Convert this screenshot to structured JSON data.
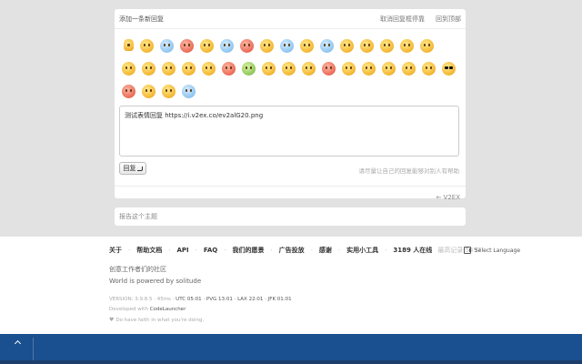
{
  "reply": {
    "title": "添加一条新回复",
    "link_unfollow": "取消回复框停靠",
    "link_top": "回到顶部",
    "textarea_value": "测试表情回复  https://i.v2ex.co/ev2alG20.png",
    "submit_label": "回复",
    "hint": "请尽量让自己的回复能够对别人有帮助",
    "back_link": "← V2EX"
  },
  "emoji_rows": [
    [
      {
        "name": "emoji-small",
        "variant": "small"
      },
      {
        "name": "emoji-grin",
        "variant": ""
      },
      {
        "name": "emoji-cry",
        "variant": "blue"
      },
      {
        "name": "emoji-angry",
        "variant": "red"
      },
      {
        "name": "emoji-wink",
        "variant": ""
      },
      {
        "name": "emoji-scared",
        "variant": "blue"
      },
      {
        "name": "emoji-mad",
        "variant": "red"
      },
      {
        "name": "emoji-shocked",
        "variant": ""
      },
      {
        "name": "emoji-sweat",
        "variant": "blue"
      },
      {
        "name": "emoji-tongue",
        "variant": ""
      },
      {
        "name": "emoji-scream",
        "variant": "blue"
      },
      {
        "name": "emoji-dizzy",
        "variant": ""
      },
      {
        "name": "emoji-sleepy",
        "variant": ""
      },
      {
        "name": "emoji-smirk",
        "variant": ""
      },
      {
        "name": "emoji-blush",
        "variant": ""
      },
      {
        "name": "emoji-happy",
        "variant": ""
      }
    ],
    [
      {
        "name": "emoji-thinking",
        "variant": ""
      },
      {
        "name": "emoji-laugh",
        "variant": ""
      },
      {
        "name": "emoji-kiss",
        "variant": ""
      },
      {
        "name": "emoji-annoyed",
        "variant": ""
      },
      {
        "name": "emoji-confused",
        "variant": ""
      },
      {
        "name": "emoji-furious",
        "variant": "red"
      },
      {
        "name": "emoji-sick",
        "variant": "green"
      },
      {
        "name": "emoji-doubt",
        "variant": ""
      },
      {
        "name": "emoji-surprised",
        "variant": ""
      },
      {
        "name": "emoji-sad",
        "variant": ""
      },
      {
        "name": "emoji-shout",
        "variant": "red"
      },
      {
        "name": "emoji-sweat-smile",
        "variant": ""
      },
      {
        "name": "emoji-smile",
        "variant": ""
      },
      {
        "name": "emoji-oops",
        "variant": ""
      },
      {
        "name": "emoji-giggle",
        "variant": ""
      },
      {
        "name": "emoji-grimace",
        "variant": ""
      },
      {
        "name": "emoji-cool",
        "variant": "cool"
      }
    ],
    [
      {
        "name": "emoji-tired",
        "variant": "red"
      },
      {
        "name": "emoji-awkward",
        "variant": ""
      },
      {
        "name": "emoji-pout",
        "variant": ""
      },
      {
        "name": "emoji-weep",
        "variant": "blue"
      }
    ]
  ],
  "report": {
    "label": "报告这个主题"
  },
  "footer": {
    "nav": [
      "关于",
      "帮助文档",
      "API",
      "FAQ",
      "我们的愿景",
      "广告投放",
      "感谢",
      "实用小工具"
    ],
    "online": "3189 人在线",
    "best_record": "最高记录 5497",
    "language": "Select Language",
    "slogan": "创意工作者们的社区",
    "powered": "World is powered by solitude",
    "version": "VERSION: 3.9.8.5 · 45ms · ",
    "clocks": "UTC 05:01 · PVG 13:01 · LAX 22:01 · JFK 01:01",
    "developed_prefix": "Developed with ",
    "developed_name": "CodeLauncher",
    "faith": "Do have faith in what you're doing."
  }
}
